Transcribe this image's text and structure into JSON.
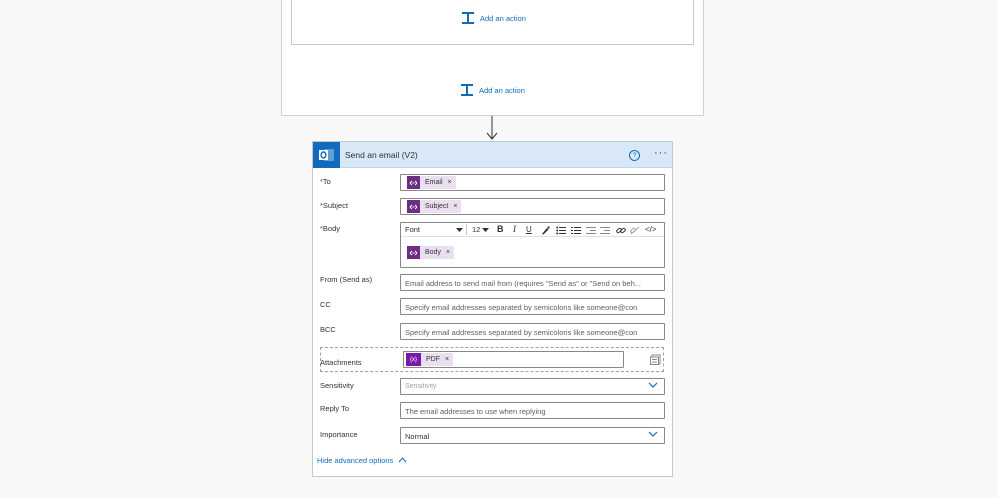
{
  "canvas": {
    "add_action_label": "Add an action",
    "add_action_label_2": "Add an action"
  },
  "card": {
    "title": "Send an email (V2)",
    "help_glyph": "?",
    "more_glyph": "···",
    "fields": {
      "to": {
        "label": "To",
        "token": "Email"
      },
      "subject": {
        "label": "Subject",
        "token": "Subject"
      },
      "body": {
        "label": "Body",
        "font": "Font",
        "font_size": "12",
        "token": "Body"
      },
      "from": {
        "label": "From (Send as)",
        "placeholder": "Email address to send mail from (requires \"Send as\" or \"Send on beh..."
      },
      "cc": {
        "label": "CC",
        "placeholder": "Specify email addresses separated by semicolons like someone@con"
      },
      "bcc": {
        "label": "BCC",
        "placeholder": "Specify email addresses separated by semicolons like someone@con"
      },
      "attachments": {
        "label": "Attachments",
        "token": "PDF",
        "token_icon": "{x}"
      },
      "sensitivity": {
        "label": "Sensitivity",
        "placeholder": "Sensitivity"
      },
      "reply_to": {
        "label": "Reply To",
        "placeholder": "The email addresses to use when replying"
      },
      "importance": {
        "label": "Importance",
        "value": "Normal"
      }
    },
    "advanced_link": "Hide advanced options",
    "required_mark": "*",
    "remove_glyph": "×"
  },
  "colors": {
    "accent": "#0f6cbd",
    "header_bg": "#d9e8f6",
    "token_bg": "#eadff0",
    "token_icon_bg": "#6c2d82",
    "variable_icon_bg": "#7719aa",
    "required": "#a4262c"
  }
}
